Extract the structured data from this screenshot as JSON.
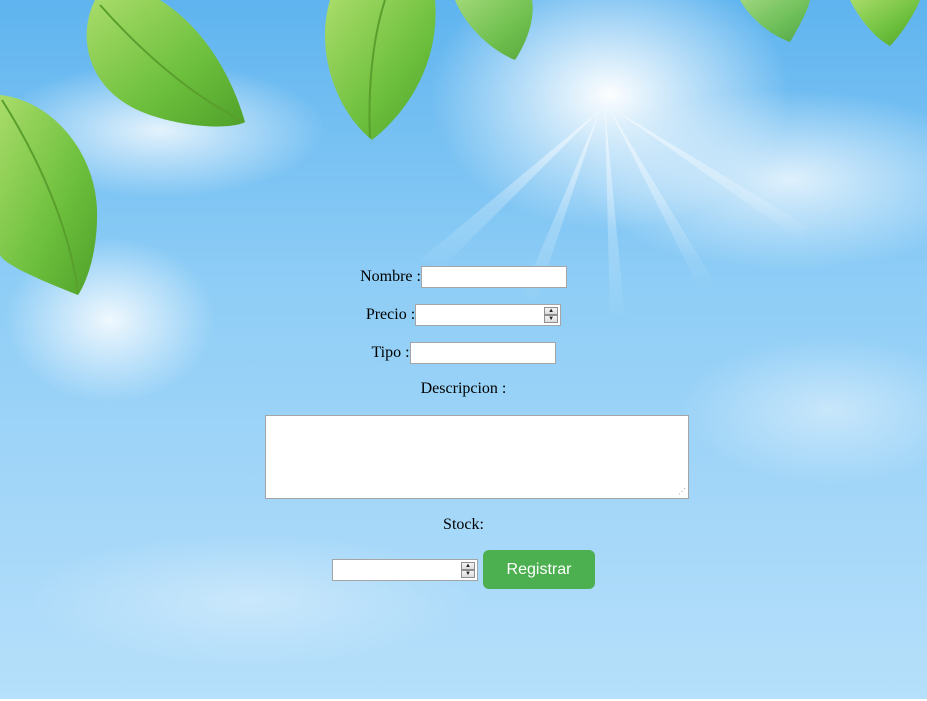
{
  "form": {
    "nombre_label": "Nombre :",
    "nombre_value": "",
    "precio_label": "Precio :",
    "precio_value": "",
    "tipo_label": "Tipo :",
    "tipo_value": "",
    "descripcion_label": "Descripcion :",
    "descripcion_value": "",
    "stock_label": "Stock:",
    "stock_value": "",
    "submit_label": "Registrar"
  },
  "icons": {
    "spinner_up": "spinner-up-icon",
    "spinner_down": "spinner-down-icon",
    "resize_grip": "resize-grip-icon"
  },
  "colors": {
    "submit_button": "#4caf50",
    "submit_text": "#ffffff",
    "sky_top": "#5fb4ef",
    "sky_bottom": "#b6e0fb",
    "leaf_green": "#6cbf3c"
  }
}
